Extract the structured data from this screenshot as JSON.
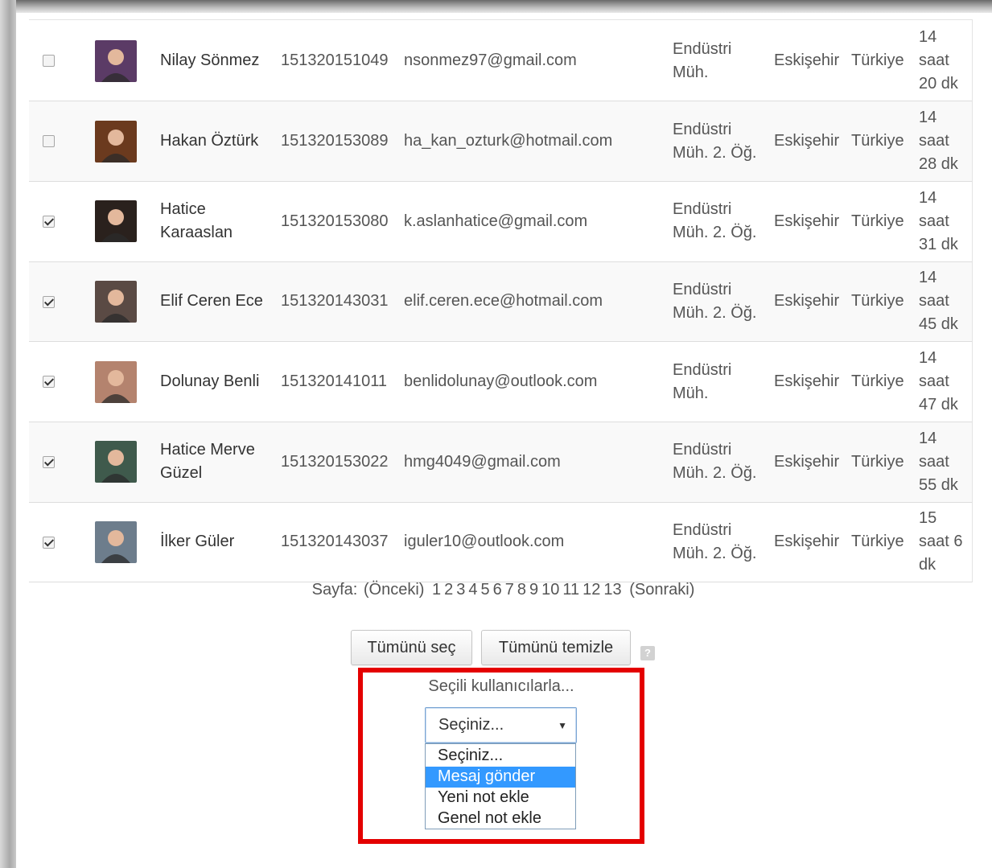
{
  "users": [
    {
      "checked": false,
      "name": "Nilay Sönmez",
      "id": "151320151049",
      "email": "nsonmez97@gmail.com",
      "department": [
        "Endüstri",
        "Müh."
      ],
      "city": "Eskişehir",
      "country": "Türkiye",
      "last_access": [
        "14",
        "saat",
        "20 dk"
      ],
      "avatar_color": "#5b3b66"
    },
    {
      "checked": false,
      "name": "Hakan Öztürk",
      "id": "151320153089",
      "email": "ha_kan_ozturk@hotmail.com",
      "department": [
        "Endüstri",
        "Müh. 2. Öğ."
      ],
      "city": "Eskişehir",
      "country": "Türkiye",
      "last_access": [
        "14",
        "saat",
        "28 dk"
      ],
      "avatar_color": "#6b3a1e"
    },
    {
      "checked": true,
      "name": "Hatice Karaaslan",
      "id": "151320153080",
      "email": "k.aslanhatice@gmail.com",
      "department": [
        "Endüstri",
        "Müh. 2. Öğ."
      ],
      "city": "Eskişehir",
      "country": "Türkiye",
      "last_access": [
        "14",
        "saat",
        "31 dk"
      ],
      "avatar_color": "#2a211d"
    },
    {
      "checked": true,
      "name": "Elif Ceren Ece",
      "id": "151320143031",
      "email": "elif.ceren.ece@hotmail.com",
      "department": [
        "Endüstri",
        "Müh. 2. Öğ."
      ],
      "city": "Eskişehir",
      "country": "Türkiye",
      "last_access": [
        "14",
        "saat",
        "45 dk"
      ],
      "avatar_color": "#5a4a44"
    },
    {
      "checked": true,
      "name": "Dolunay Benli",
      "id": "151320141011",
      "email": "benlidolunay@outlook.com",
      "department": [
        "Endüstri",
        "Müh."
      ],
      "city": "Eskişehir",
      "country": "Türkiye",
      "last_access": [
        "14",
        "saat",
        "47 dk"
      ],
      "avatar_color": "#b4836e"
    },
    {
      "checked": true,
      "name": "Hatice Merve Güzel",
      "id": "151320153022",
      "email": "hmg4049@gmail.com",
      "department": [
        "Endüstri",
        "Müh. 2. Öğ."
      ],
      "city": "Eskişehir",
      "country": "Türkiye",
      "last_access": [
        "14",
        "saat",
        "55 dk"
      ],
      "avatar_color": "#3f5a4c"
    },
    {
      "checked": true,
      "name": "İlker Güler",
      "id": "151320143037",
      "email": "iguler10@outlook.com",
      "department": [
        "Endüstri",
        "Müh. 2. Öğ."
      ],
      "city": "Eskişehir",
      "country": "Türkiye",
      "last_access": [
        "15",
        "saat 6",
        "dk"
      ],
      "avatar_color": "#6d7d8c"
    }
  ],
  "paging": {
    "label": "Sayfa:",
    "prev": "(Önceki)",
    "pages": [
      "1",
      "2",
      "3",
      "4",
      "5",
      "6",
      "7",
      "8",
      "9",
      "10",
      "11",
      "12",
      "13"
    ],
    "next": "(Sonraki)"
  },
  "actions": {
    "select_all": "Tümünü seç",
    "clear_all": "Tümünü temizle",
    "help": "?"
  },
  "bulk": {
    "label": "Seçili kullanıcılarla...",
    "selected_value": "Seçiniz...",
    "options": [
      "Seçiniz...",
      "Mesaj gönder",
      "Yeni not ekle",
      "Genel not ekle"
    ],
    "highlighted_option": "Mesaj gönder"
  },
  "colors": {
    "highlight_border": "#e40000",
    "option_highlight": "#3399ff"
  }
}
